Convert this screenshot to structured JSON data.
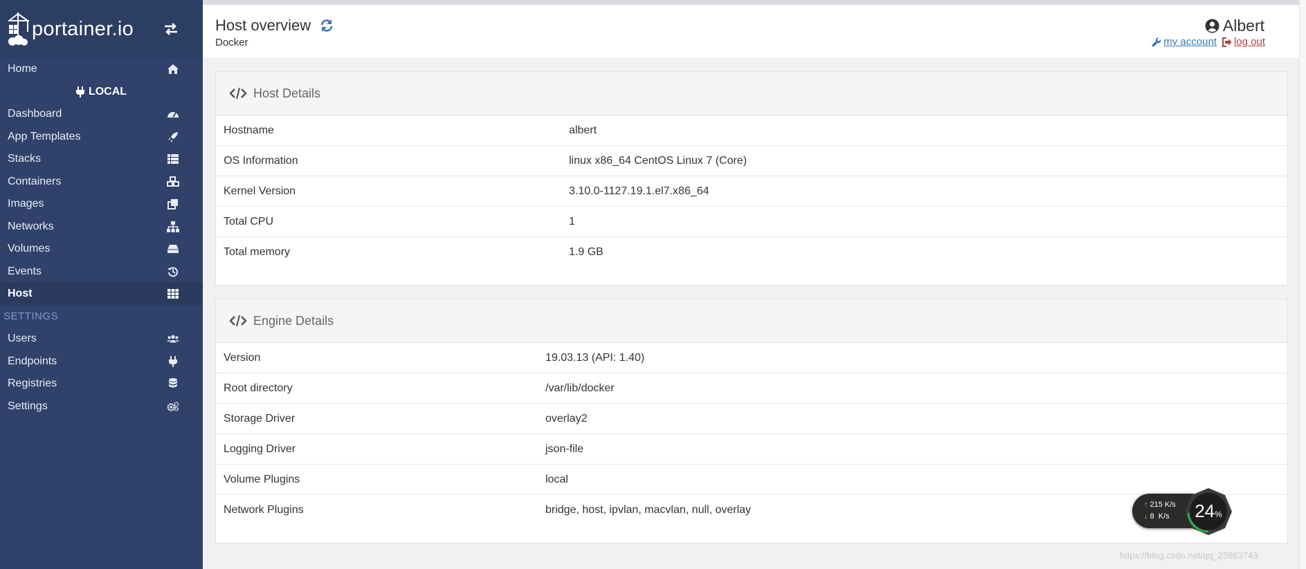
{
  "app": {
    "logo_text": "portainer.io"
  },
  "sidebar": {
    "home": "Home",
    "endpoint": "LOCAL",
    "items": [
      {
        "label": "Dashboard",
        "icon": "tachometer-icon"
      },
      {
        "label": "App Templates",
        "icon": "rocket-icon"
      },
      {
        "label": "Stacks",
        "icon": "th-list-icon"
      },
      {
        "label": "Containers",
        "icon": "cubes-icon"
      },
      {
        "label": "Images",
        "icon": "clone-icon"
      },
      {
        "label": "Networks",
        "icon": "sitemap-icon"
      },
      {
        "label": "Volumes",
        "icon": "hdd-icon"
      },
      {
        "label": "Events",
        "icon": "history-icon"
      },
      {
        "label": "Host",
        "icon": "th-icon",
        "active": true
      }
    ],
    "settings_header": "SETTINGS",
    "settings_items": [
      {
        "label": "Users",
        "icon": "users-icon"
      },
      {
        "label": "Endpoints",
        "icon": "plug-icon"
      },
      {
        "label": "Registries",
        "icon": "database-icon"
      },
      {
        "label": "Settings",
        "icon": "cogs-icon"
      }
    ]
  },
  "header": {
    "title": "Host overview",
    "subtitle": "Docker",
    "user": "Albert",
    "my_account": "my account",
    "log_out": "log out"
  },
  "host_details": {
    "title": "Host Details",
    "rows": [
      {
        "key": "Hostname",
        "value": "albert"
      },
      {
        "key": "OS Information",
        "value": "linux x86_64 CentOS Linux 7 (Core)"
      },
      {
        "key": "Kernel Version",
        "value": "3.10.0-1127.19.1.el7.x86_64"
      },
      {
        "key": "Total CPU",
        "value": "1"
      },
      {
        "key": "Total memory",
        "value": "1.9 GB"
      }
    ]
  },
  "engine_details": {
    "title": "Engine Details",
    "rows": [
      {
        "key": "Version",
        "value": "19.03.13 (API: 1.40)"
      },
      {
        "key": "Root directory",
        "value": "/var/lib/docker"
      },
      {
        "key": "Storage Driver",
        "value": "overlay2"
      },
      {
        "key": "Logging Driver",
        "value": "json-file"
      },
      {
        "key": "Volume Plugins",
        "value": "local"
      },
      {
        "key": "Network Plugins",
        "value": "bridge, host, ipvlan, macvlan, null, overlay"
      }
    ]
  },
  "net_widget": {
    "up_speed": "215 K/s",
    "down_speed": "8  K/s",
    "percent": "24",
    "percent_sign": "%",
    "level": 0.24
  },
  "watermark": "https://blog.csdn.net/qq_23863743",
  "colors": {
    "sidebar": "#30426a",
    "accent": "#337ab7",
    "logout": "#a94442"
  }
}
